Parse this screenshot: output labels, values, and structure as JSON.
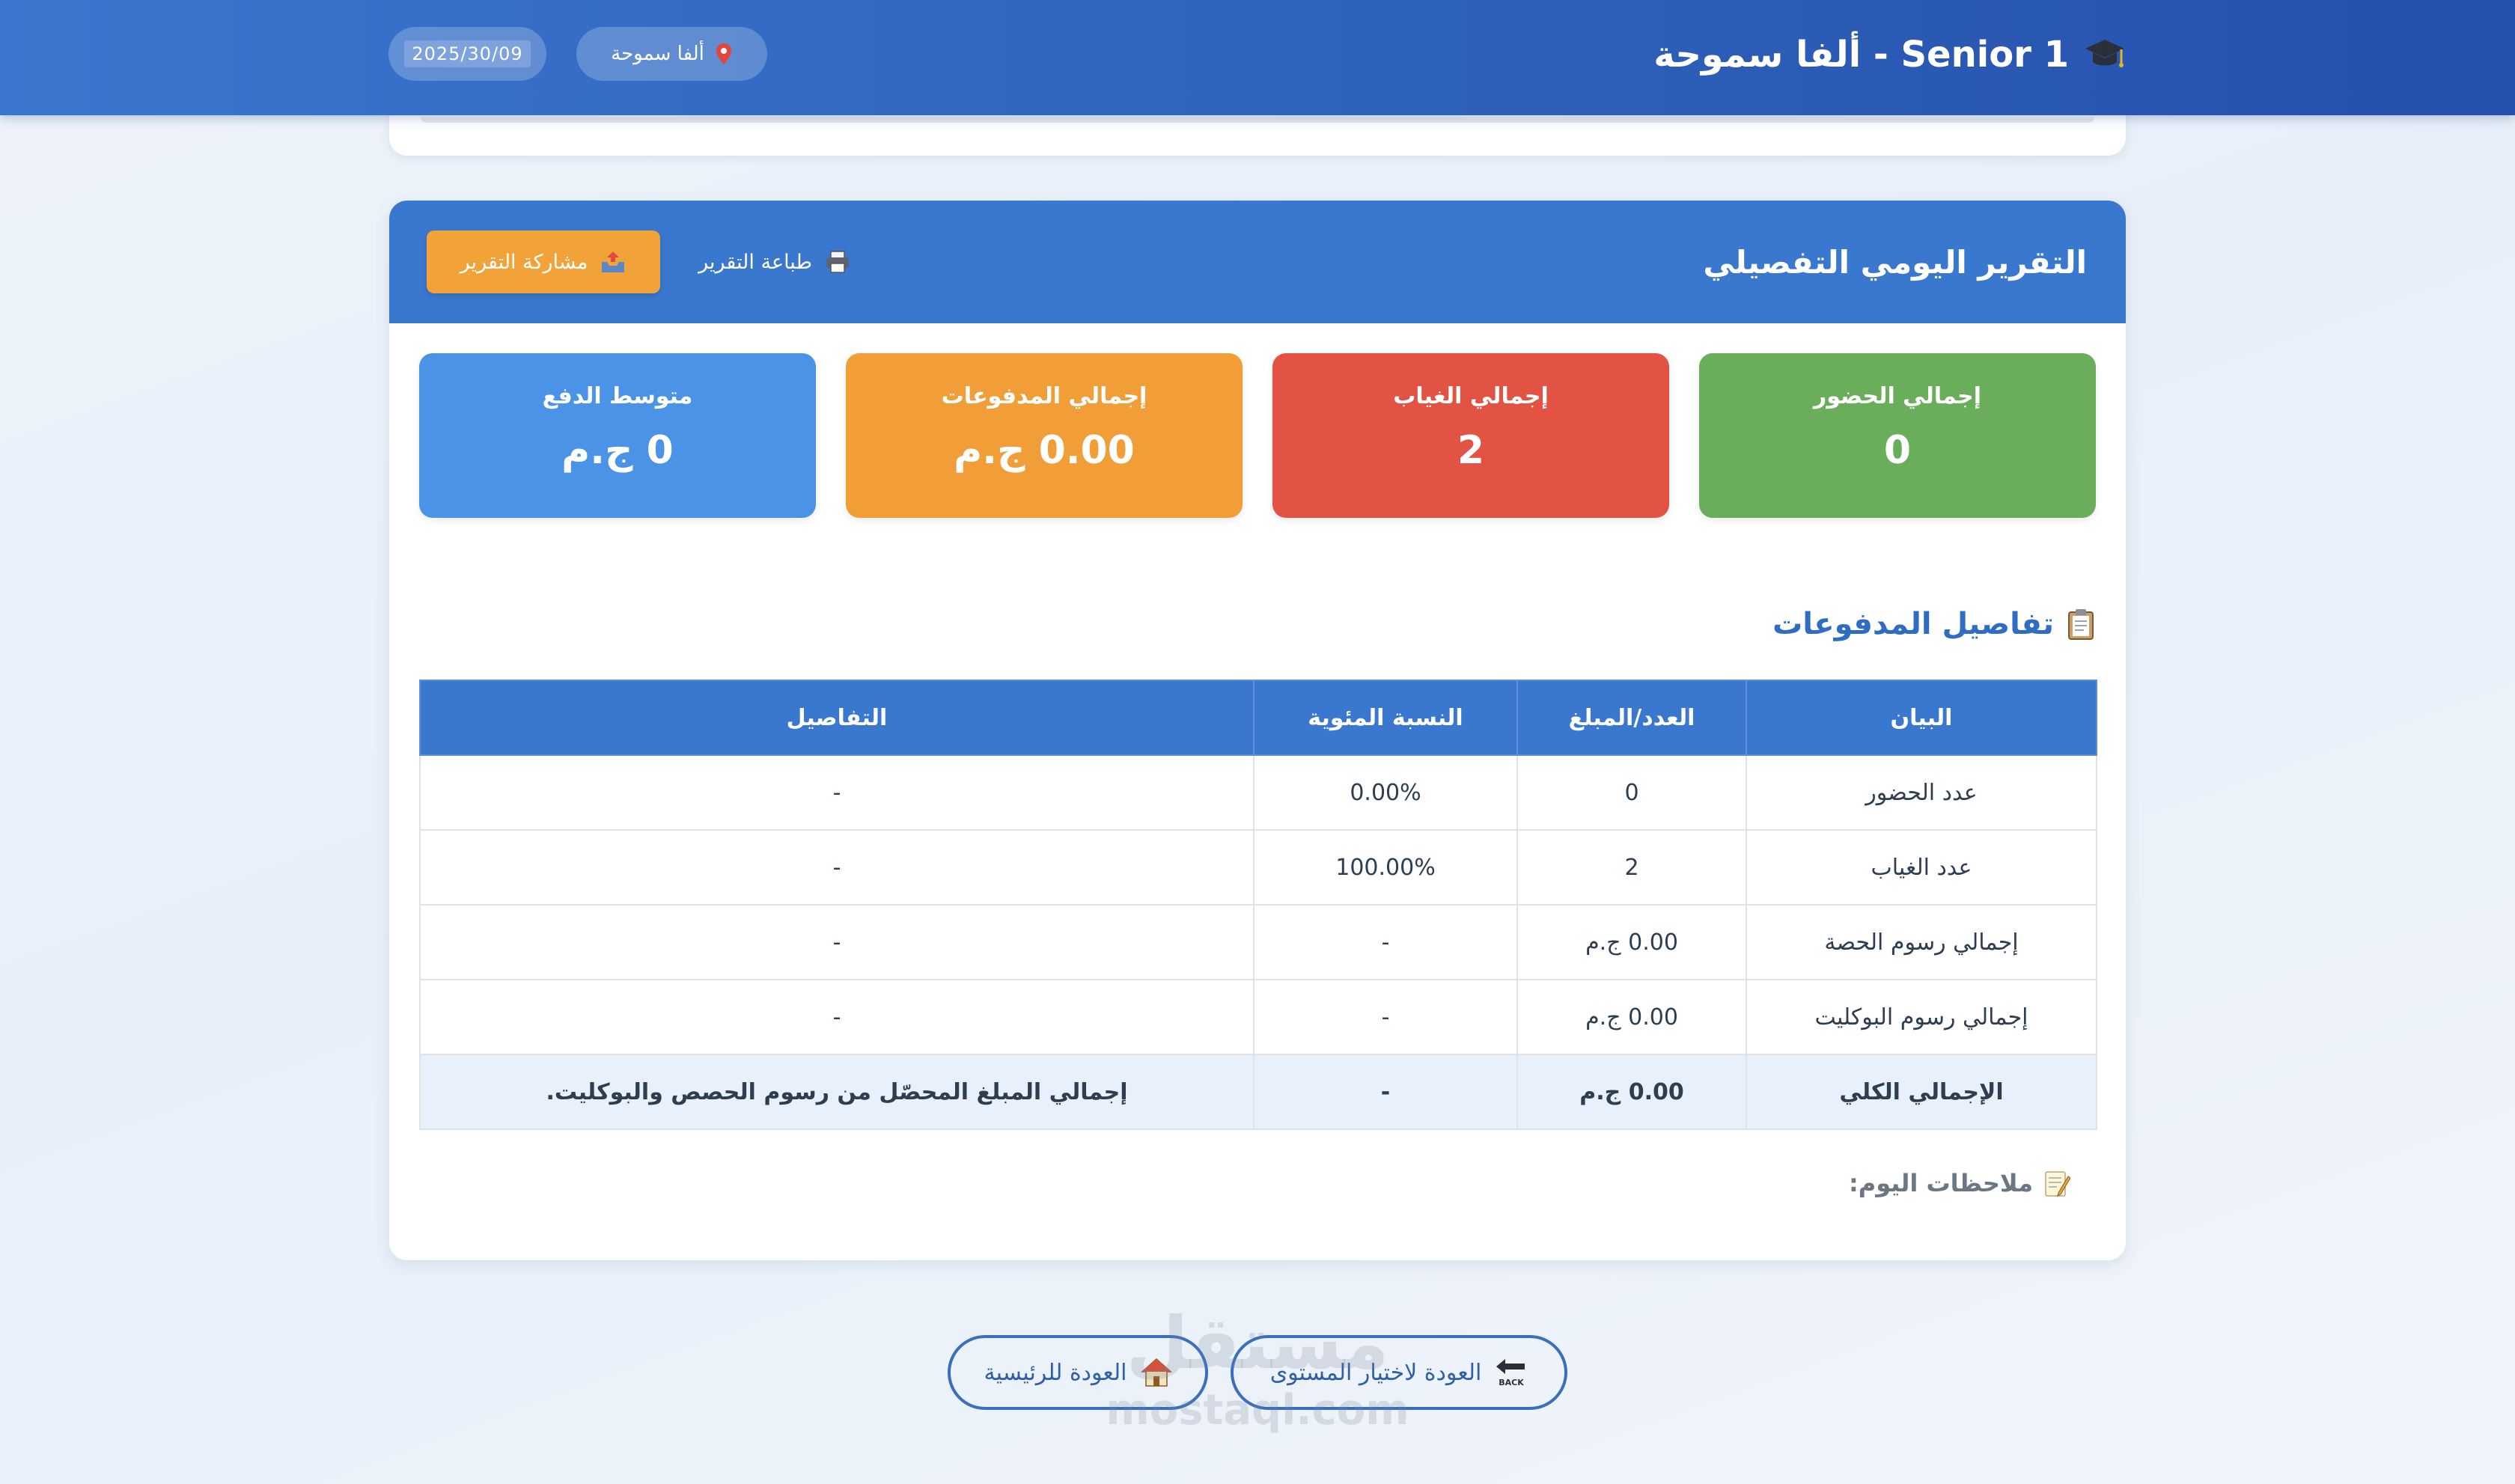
{
  "header": {
    "title": "Senior 1 - ألفا سموحة",
    "location": "ألفا سموحة",
    "date": "2025/30/09"
  },
  "report": {
    "title": "التقرير اليومي التفصيلي",
    "print_label": "طباعة التقرير",
    "share_label": "مشاركة التقرير"
  },
  "stats": {
    "attendance": {
      "label": "إجمالي الحضور",
      "value": "0",
      "color": "#6aae5c"
    },
    "absence": {
      "label": "إجمالي الغياب",
      "value": "2",
      "color": "#e35343"
    },
    "payments": {
      "label": "إجمالي المدفوعات",
      "value": "0.00 ج.م",
      "color": "#f19e38"
    },
    "average": {
      "label": "متوسط الدفع",
      "value": "0 ج.م",
      "color": "#4a93e6"
    }
  },
  "payments_section": {
    "title": "تفاصيل المدفوعات",
    "columns": [
      "البيان",
      "العدد/المبلغ",
      "النسبة المئوية",
      "التفاصيل"
    ],
    "rows": [
      [
        "عدد الحضور",
        "0",
        "0.00%",
        "-"
      ],
      [
        "عدد الغياب",
        "2",
        "100.00%",
        "-"
      ],
      [
        "إجمالي رسوم الحصة",
        "0.00 ج.م",
        "-",
        "-"
      ],
      [
        "إجمالي رسوم البوكليت",
        "0.00 ج.م",
        "-",
        "-"
      ]
    ],
    "total": [
      "الإجمالي الكلي",
      "0.00 ج.م",
      "-",
      "إجمالي المبلغ المحصّل من رسوم الحصص والبوكليت."
    ]
  },
  "notes": {
    "label": "ملاحظات اليوم:"
  },
  "nav": {
    "back_level": "العودة لاختيار المستوى",
    "home": "العودة للرئيسية",
    "back_badge": "BACK"
  },
  "watermark": {
    "arabic": "مستقل",
    "latin": "mostaql.com"
  },
  "icons": {
    "title": "graduation-cap-icon",
    "location": "pin-icon",
    "print": "printer-icon",
    "share": "outbox-tray-icon",
    "section": "clipboard-icon",
    "notes": "memo-icon",
    "back": "back-arrow-icon",
    "home": "house-icon"
  }
}
